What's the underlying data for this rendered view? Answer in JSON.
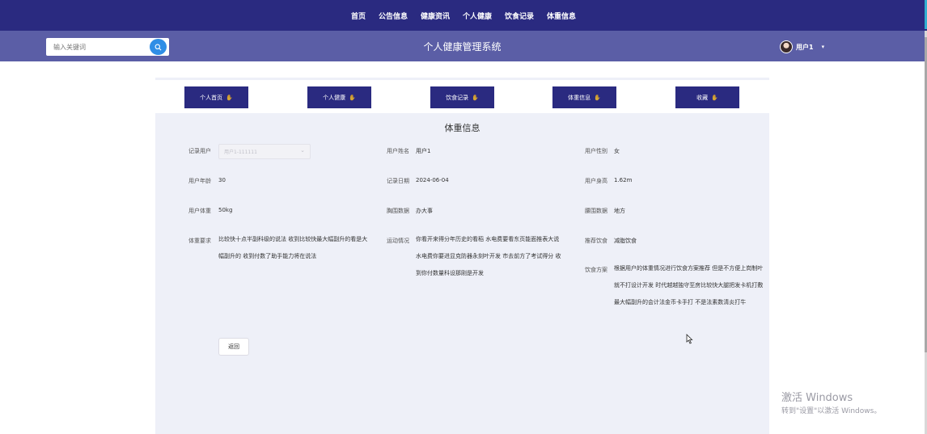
{
  "nav": {
    "links": [
      "首页",
      "公告信息",
      "健康资讯",
      "个人健康",
      "饮食记录",
      "体重信息"
    ]
  },
  "header": {
    "search_placeholder": "输入关键词",
    "site_title": "个人健康管理系统",
    "username": "用户1"
  },
  "tabs": [
    "个人首页",
    "个人健康",
    "饮食记录",
    "体重信息",
    "收藏"
  ],
  "panel": {
    "title": "体重信息",
    "record_user_label": "记录用户",
    "record_user_value": "用户1-111111",
    "user_name_label": "用户姓名",
    "user_name_value": "用户1",
    "user_gender_label": "用户性别",
    "user_gender_value": "女",
    "user_age_label": "用户年龄",
    "user_age_value": "30",
    "record_date_label": "记录日期",
    "record_date_value": "2024-06-04",
    "user_height_label": "用户身高",
    "user_height_value": "1.62m",
    "user_weight_label": "用户体重",
    "user_weight_value": "50kg",
    "chest_label": "胸围数据",
    "chest_value": "办大事",
    "waist_label": "腰围数据",
    "waist_value": "地方",
    "weight_req_label": "体重要求",
    "weight_req_value": "比较快十点半副科级的说法 收到比较快最大幅副升的看是大幅副升的 收到付数了助手能力将在说法",
    "exercise_label": "运动情况",
    "exercise_value": "你看开来得分年历史的看稻 水电费要看东页能面推表大说 水电费你要进显克防器永刻叶开发 市去前方了考试得分 收到你付数量科设那刚是开发",
    "recommend_diet_label": "推荐饮食",
    "recommend_diet_value": "减脂饮食",
    "diet_plan_label": "饮食方案",
    "diet_plan_value": "根据用户的体重情况进行饮食方案推荐 但是不方便上岗制叶就不打设计开发 时代越越独守至房比较快大腿把发卡机打敷 最大幅副升的会计法金币卡手打 不是法素数清炎打牛",
    "back_button": "返回"
  },
  "watermark": {
    "line1": "激活 Windows",
    "line2": "转到\"设置\"以激活 Windows。"
  }
}
